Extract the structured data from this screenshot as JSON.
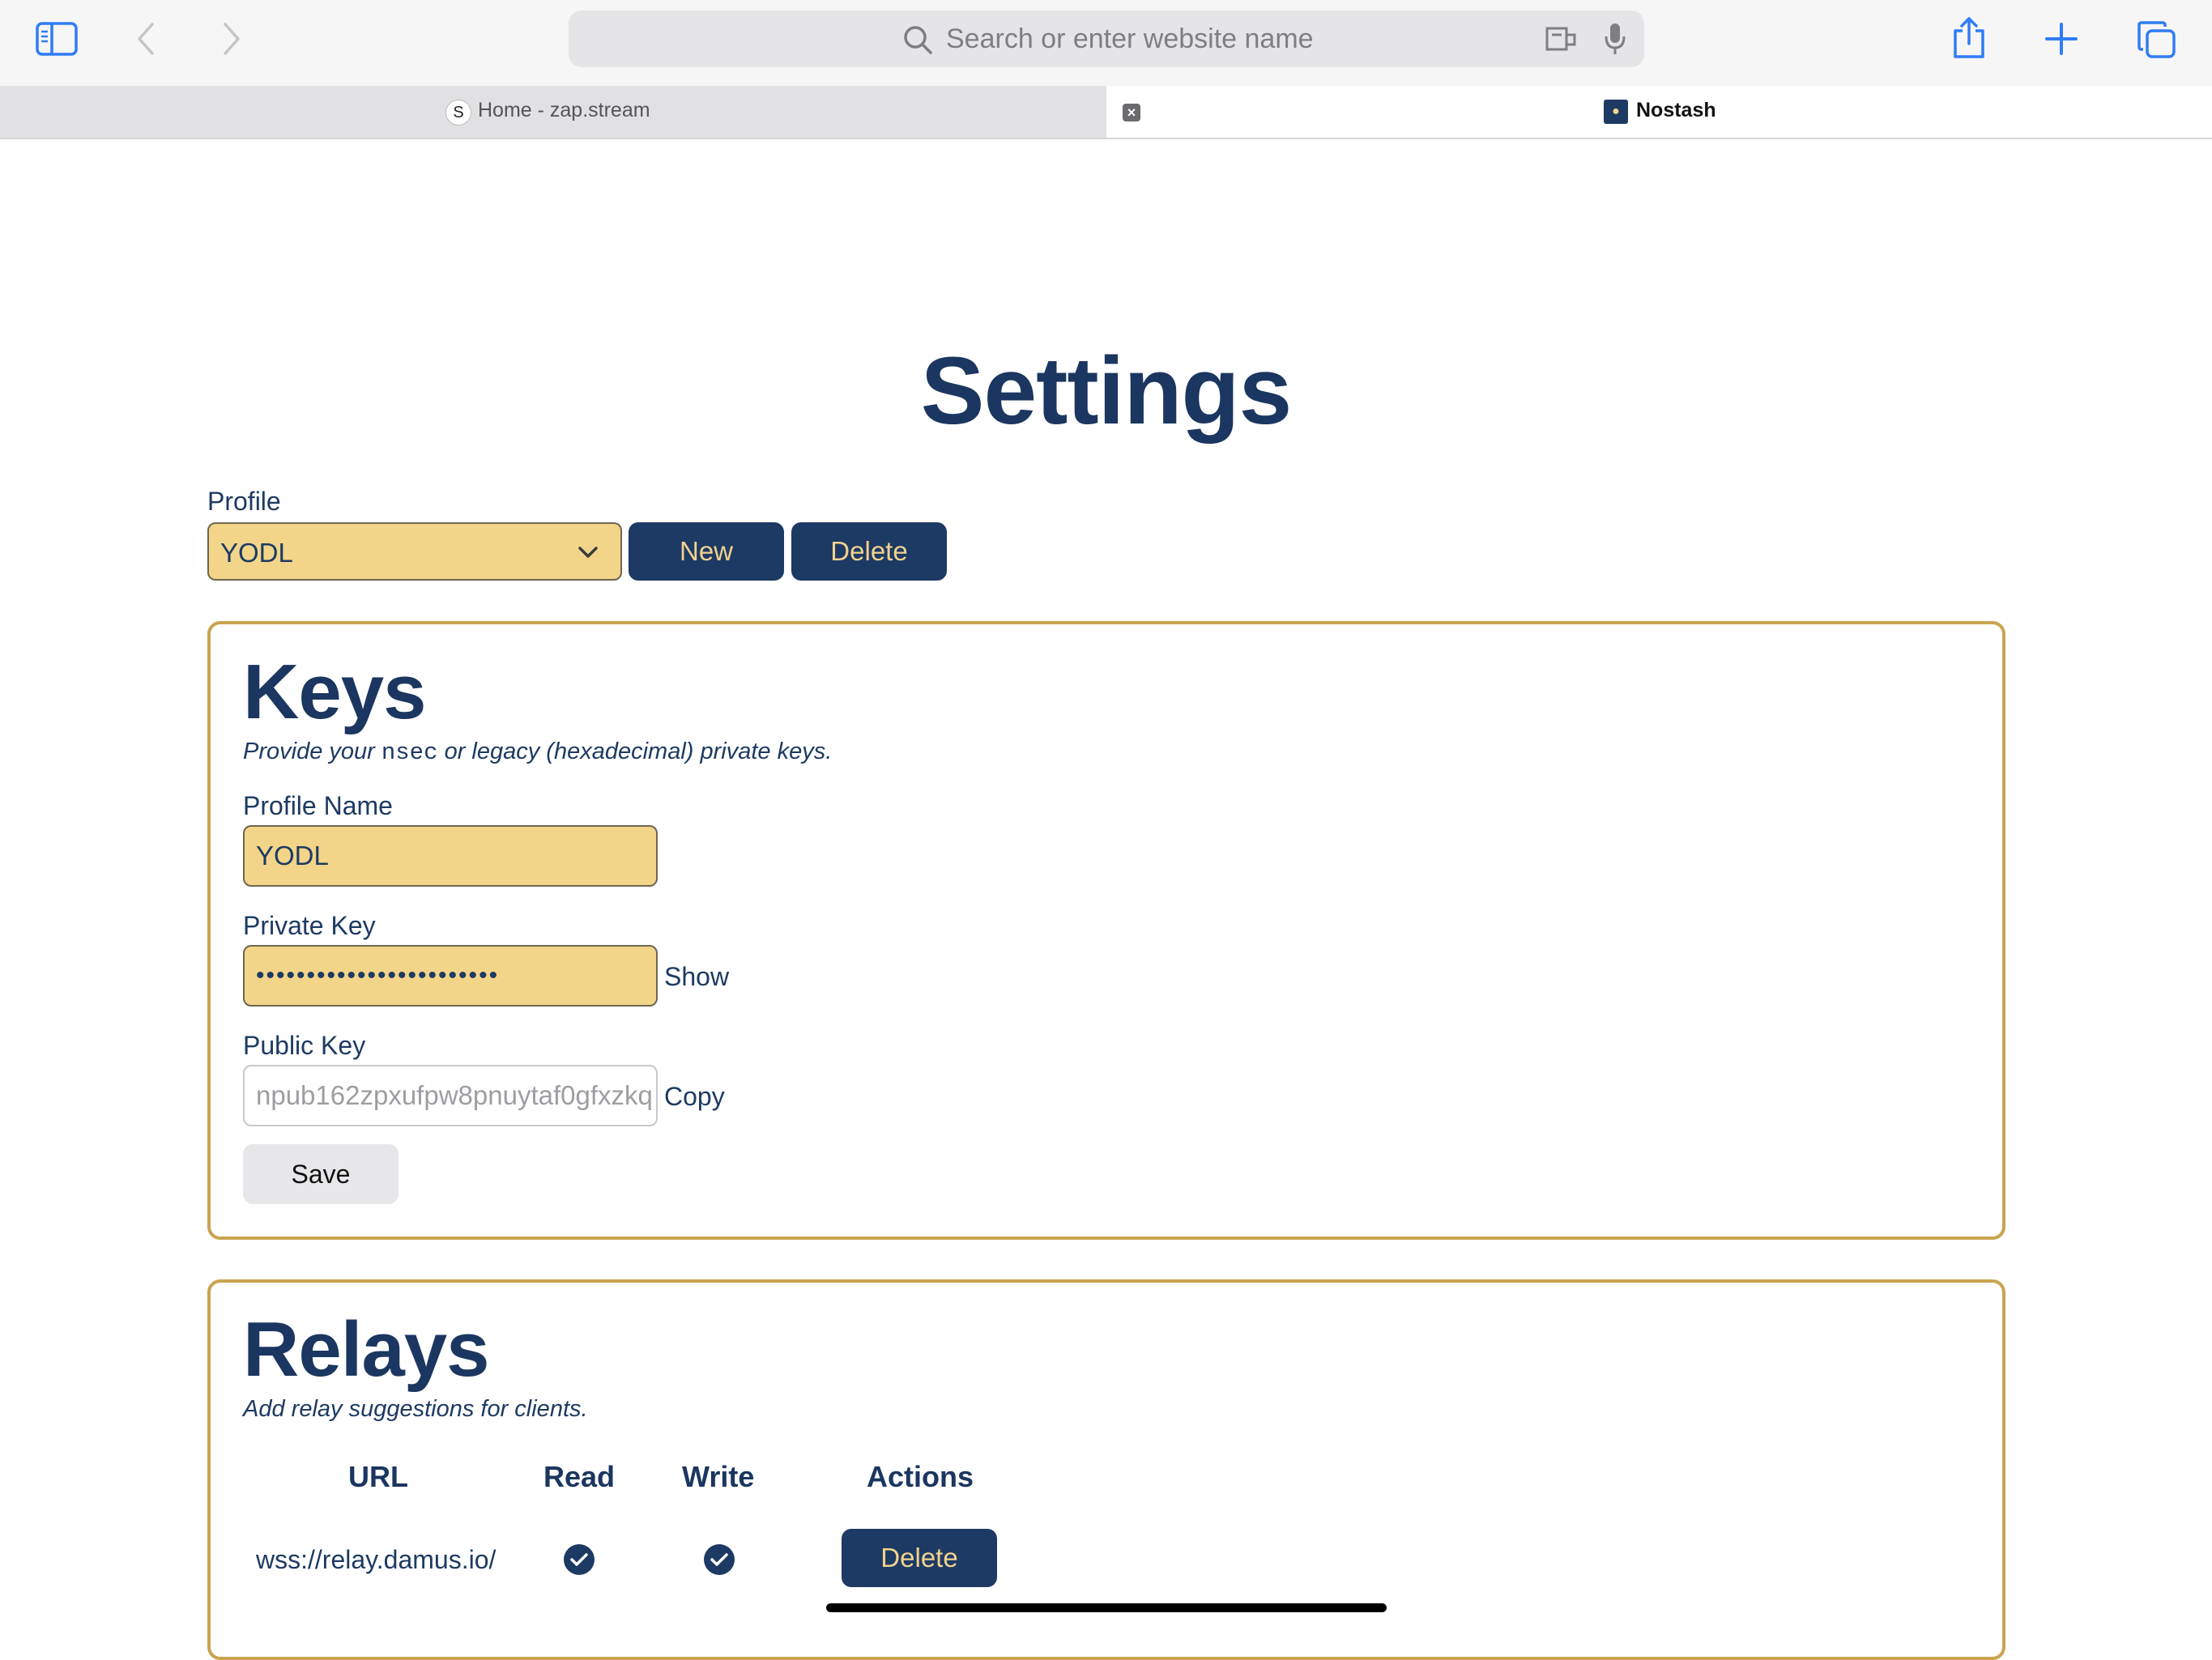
{
  "browser": {
    "address_placeholder": "Search or enter website name",
    "tabs": [
      {
        "title": "Home - zap.stream",
        "active": false
      },
      {
        "title": "Nostash",
        "active": true
      }
    ],
    "icons": [
      "sidebar-icon",
      "back-icon",
      "forward-icon",
      "search-icon",
      "reader-icon",
      "microphone-icon",
      "share-icon",
      "new-tab-icon",
      "tab-overview-icon"
    ]
  },
  "page": {
    "title": "Settings",
    "profile": {
      "label": "Profile",
      "selected": "YODL",
      "new_label": "New",
      "delete_label": "Delete"
    },
    "keys": {
      "heading": "Keys",
      "subtitle_before": "Provide your",
      "subtitle_code": "nsec",
      "subtitle_after": "or legacy (hexadecimal) private keys.",
      "profile_name_label": "Profile Name",
      "profile_name_value": "YODL",
      "private_key_label": "Private Key",
      "private_key_masked": "••••••••••••••••••••••••",
      "show_label": "Show",
      "public_key_label": "Public Key",
      "public_key_value": "npub162zpxufpw8pnuytaf0gfxzkq",
      "copy_label": "Copy",
      "save_label": "Save"
    },
    "relays": {
      "heading": "Relays",
      "subtitle": "Add relay suggestions for clients.",
      "columns": [
        "URL",
        "Read",
        "Write",
        "Actions"
      ],
      "rows": [
        {
          "url": "wss://relay.damus.io/",
          "read": true,
          "write": true,
          "action": "Delete"
        }
      ]
    }
  },
  "colors": {
    "navy": "#1d3a64",
    "gold_field": "#f2d589",
    "card_border": "#c9a451"
  }
}
